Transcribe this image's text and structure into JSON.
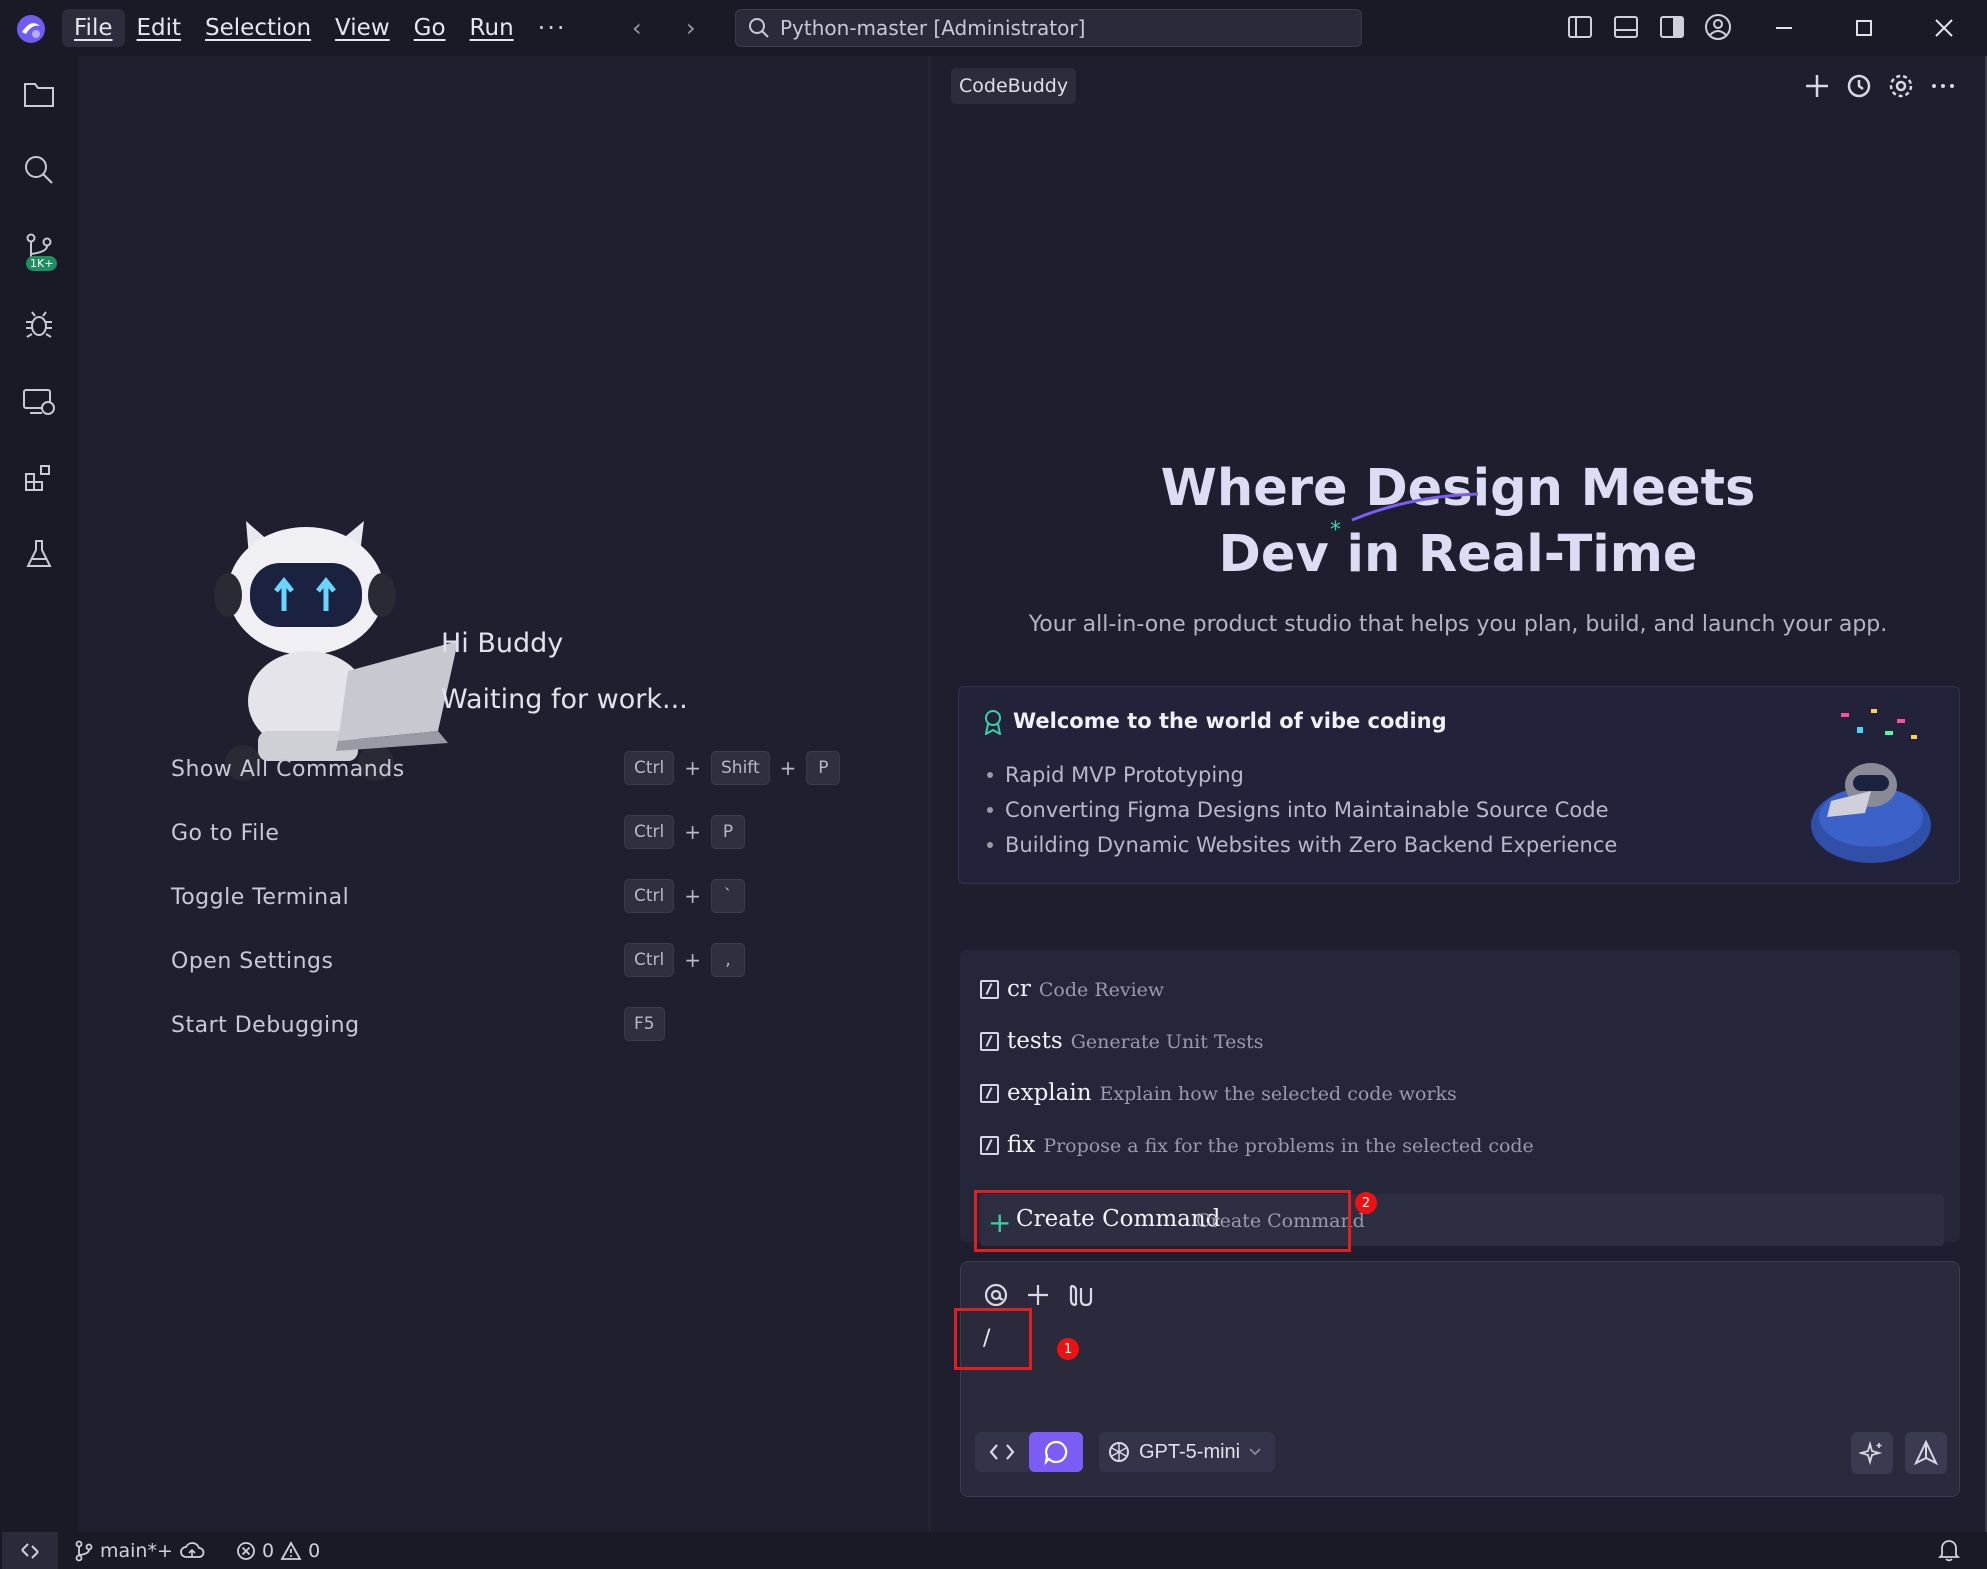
{
  "titlebar": {
    "menu": [
      "File",
      "Edit",
      "Selection",
      "View",
      "Go",
      "Run"
    ],
    "more": "···",
    "back_arrow": "‹",
    "forward_arrow": "›",
    "search_text": "Python-master [Administrator]"
  },
  "activity_icons": [
    "explorer-icon",
    "search-icon",
    "source-control-icon",
    "debug-icon",
    "remote-explorer-icon",
    "extensions-icon",
    "testing-icon"
  ],
  "scm_badge": "1K+",
  "greeting": {
    "title": "Hi Buddy",
    "subtitle": "Waiting for work..."
  },
  "shortcuts": [
    {
      "label": "Show All Commands",
      "keys": [
        "Ctrl",
        "+",
        "Shift",
        "+",
        "P"
      ]
    },
    {
      "label": "Go to File",
      "keys": [
        "Ctrl",
        "+",
        "P"
      ]
    },
    {
      "label": "Toggle Terminal",
      "keys": [
        "Ctrl",
        "+",
        "`"
      ]
    },
    {
      "label": "Open Settings",
      "keys": [
        "Ctrl",
        "+",
        ","
      ]
    },
    {
      "label": "Start Debugging",
      "keys": [
        "F5"
      ]
    }
  ],
  "panel": {
    "tab": "CodeBuddy",
    "hero_line1": "Where Design Meets",
    "hero_line2": "Dev in Real-Time",
    "hero_sub": "Your all-in-one product studio that helps you plan, build, and launch your app.",
    "welcome_title": "Welcome to the world of vibe coding",
    "welcome_items": [
      "Rapid MVP Prototyping",
      "Converting Figma Designs into Maintainable Source Code",
      "Building Dynamic Websites with Zero Backend Experience"
    ],
    "commands": [
      {
        "name": "cr",
        "desc": "Code Review"
      },
      {
        "name": "tests",
        "desc": "Generate Unit Tests"
      },
      {
        "name": "explain",
        "desc": "Explain how the selected code works"
      },
      {
        "name": "fix",
        "desc": "Propose a fix for the problems in the selected code"
      }
    ],
    "create_command": {
      "name": "Create Command",
      "desc": "Create Command"
    },
    "input_value": "/",
    "model": "GPT-5-mini",
    "badge1": "1",
    "badge2": "2"
  },
  "statusbar": {
    "branch": "main*+",
    "errors": "0",
    "warnings": "0"
  },
  "colors": {
    "accent": "#7b5cf5",
    "highlight_box": "#e02020",
    "plus_green": "#38d2a8"
  }
}
